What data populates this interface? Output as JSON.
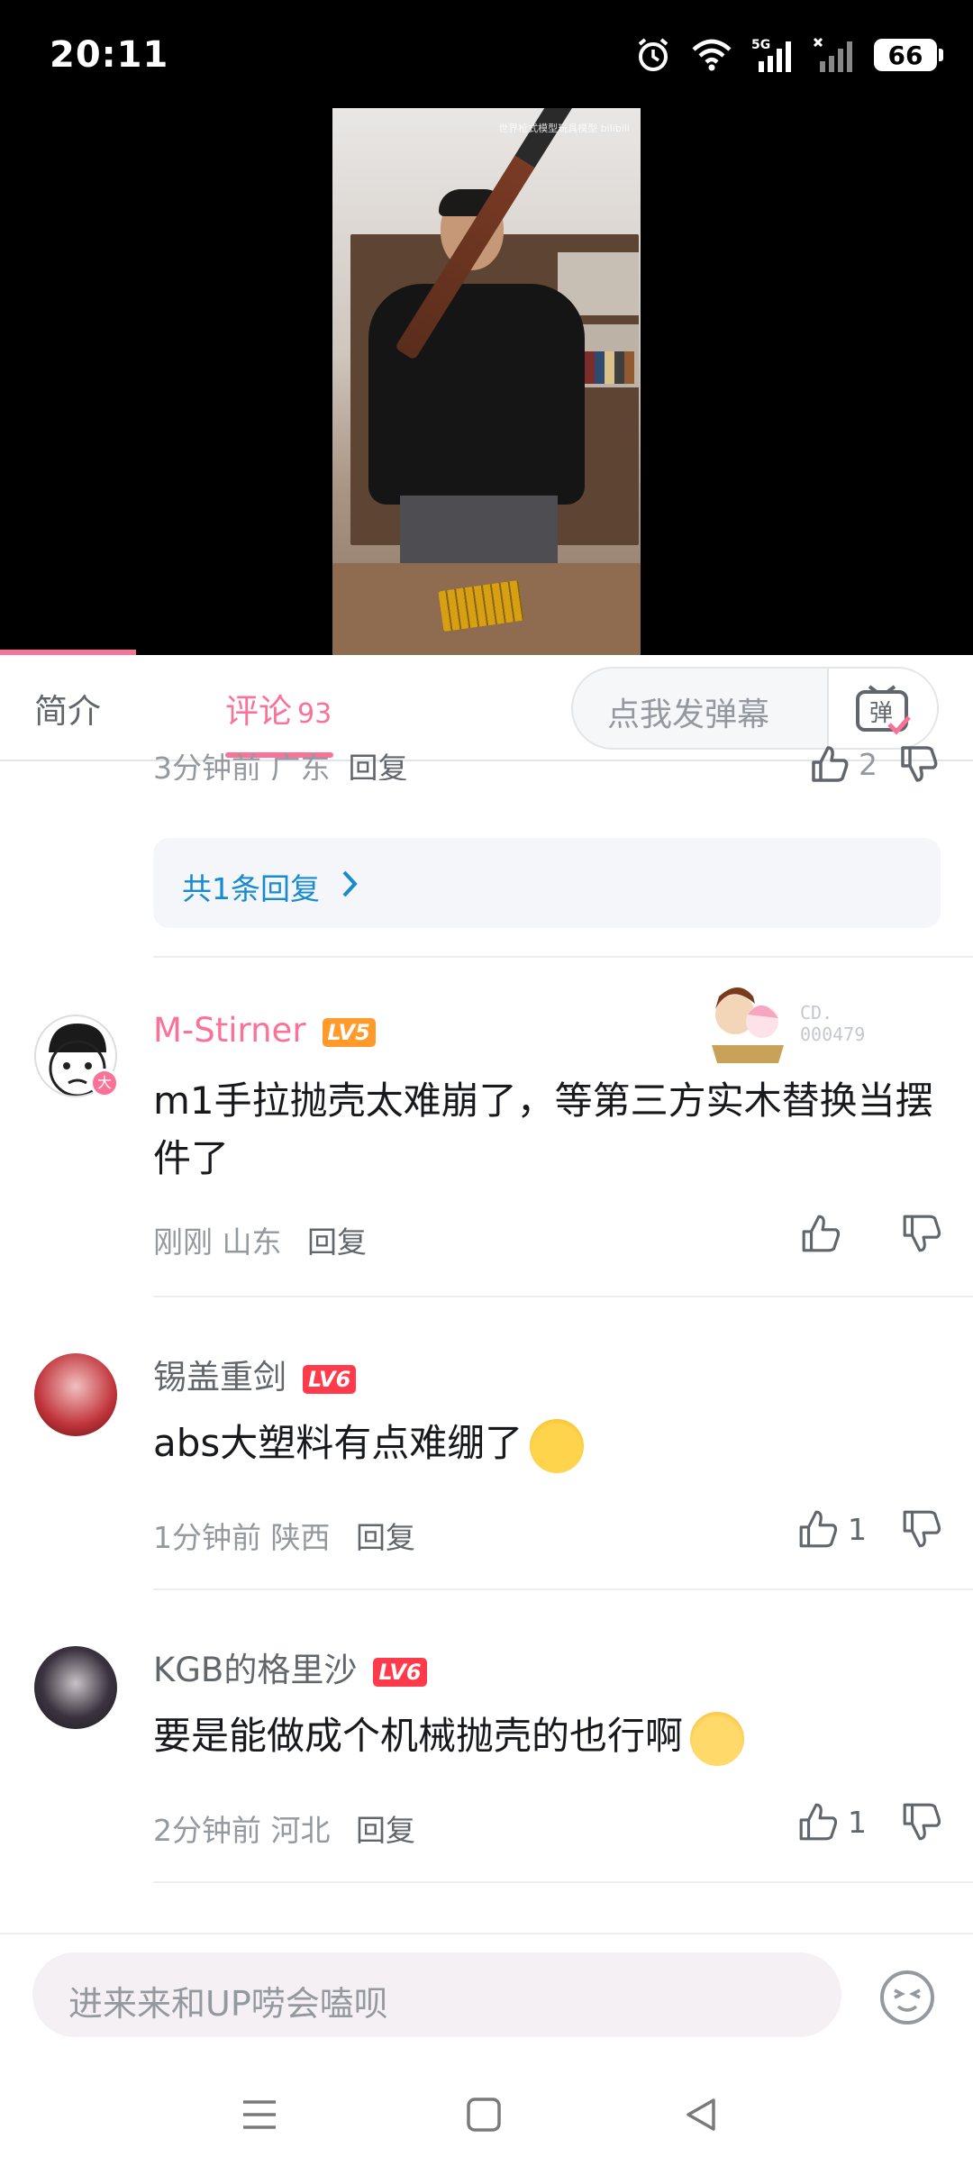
{
  "status_bar": {
    "time": "20:11",
    "network": "5G",
    "battery": "66",
    "icons": [
      "alarm-icon",
      "wifi-icon",
      "signal-5g-icon",
      "signal-no-sim-icon",
      "battery-icon"
    ]
  },
  "video": {
    "watermark": "世界枪式模型玩具模型 bilibili",
    "progress_fraction": 0.14
  },
  "tabs": {
    "intro": "简介",
    "comments": "评论",
    "comments_count": "93",
    "danmaku_placeholder": "点我发弹幕",
    "danmaku_button": "弹"
  },
  "previous_comment": {
    "meta": "3分钟前 广东",
    "reply_label": "回复",
    "likes": "2",
    "fold_replies": "共1条回复"
  },
  "comments": [
    {
      "username": "M-Stirner",
      "level": "LV5",
      "badge_id": "CD.\n000479",
      "text": "m1手拉抛壳太难崩了，等第三方实木替换当摆件了",
      "time": "刚刚",
      "location": "山东",
      "reply_label": "回复",
      "likes": ""
    },
    {
      "username": "锡盖重剑",
      "level": "LV6",
      "text": "abs大塑料有点难绷了",
      "emoji": "crying-laugh-emoji",
      "time": "1分钟前",
      "location": "陕西",
      "reply_label": "回复",
      "likes": "1"
    },
    {
      "username": "KGB的格里沙",
      "level": "LV6",
      "text": "要是能做成个机械抛壳的也行啊",
      "emoji": "laughing-emoji",
      "time": "2分钟前",
      "location": "河北",
      "reply_label": "回复",
      "likes": "1"
    }
  ],
  "composer": {
    "placeholder": "进来来和UP唠会嗑呗"
  },
  "colors": {
    "accent": "#fb7299",
    "link": "#178bcf",
    "lv5": "#ff9a2b",
    "lv6": "#ff3a4b"
  }
}
